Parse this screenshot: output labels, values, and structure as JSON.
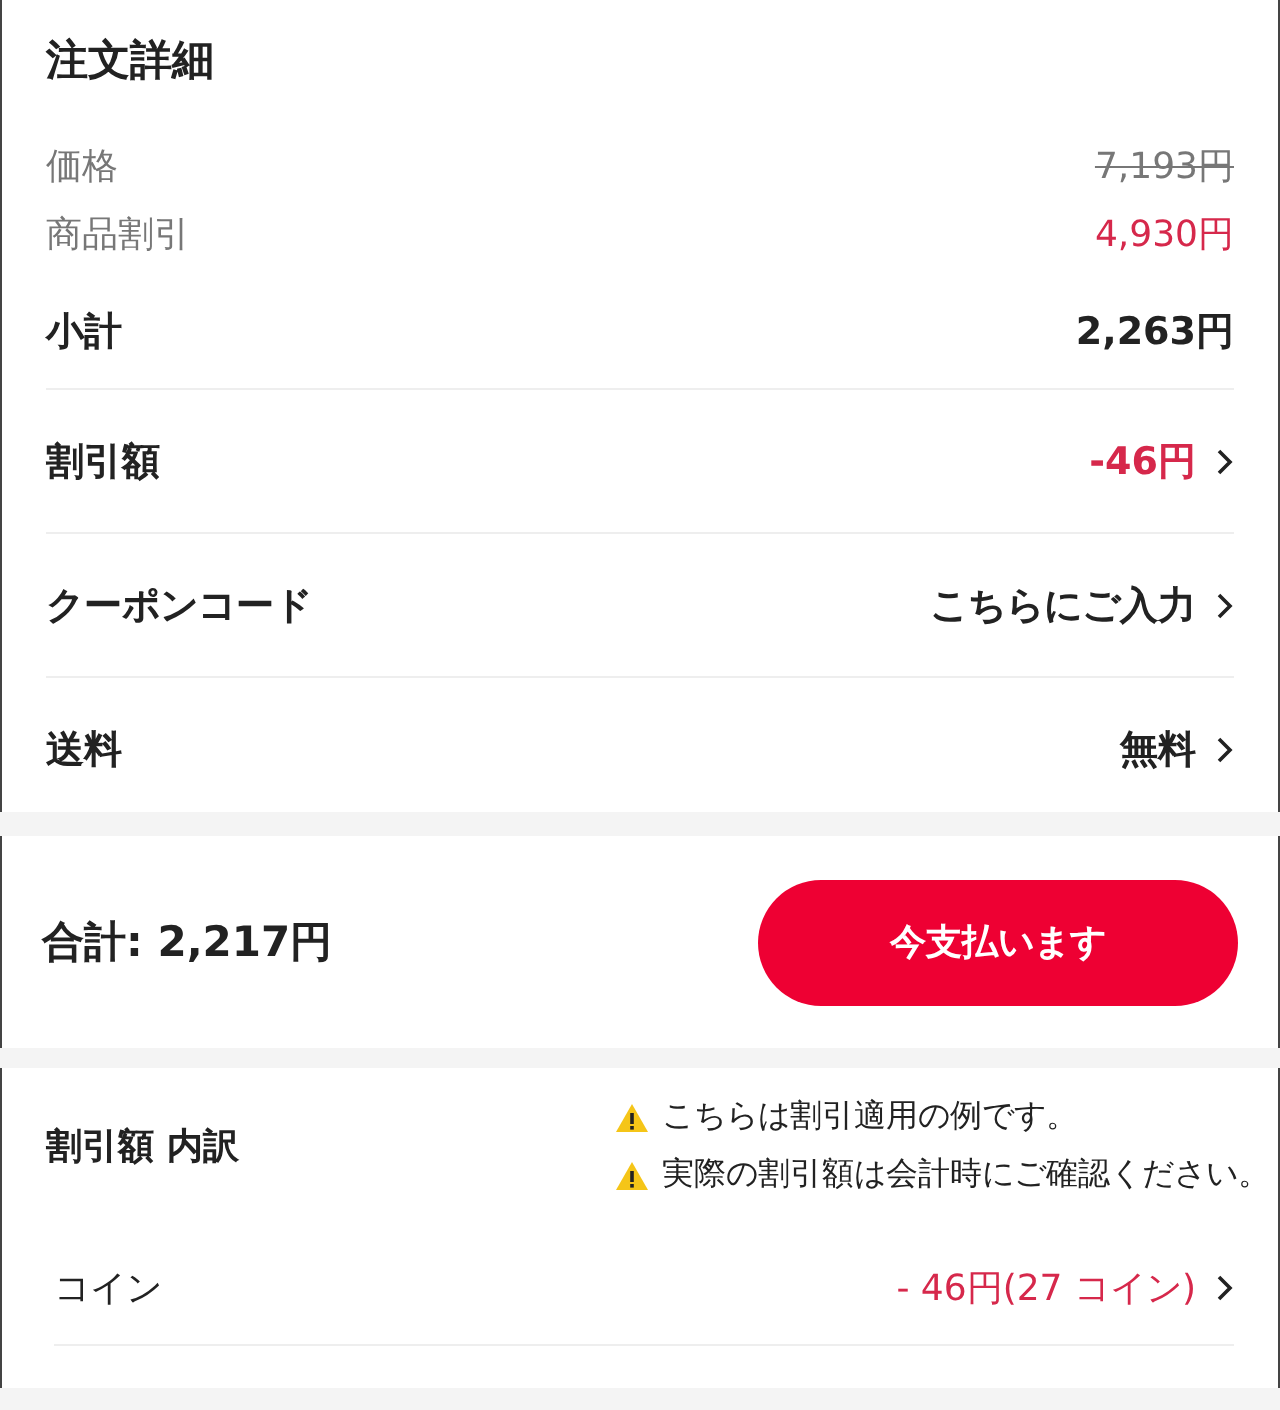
{
  "order_details": {
    "title": "注文詳細",
    "rows": [
      {
        "kind": "minor",
        "label": "価格",
        "value": "7,193円",
        "struck": true,
        "red": false,
        "chevron": false
      },
      {
        "kind": "minor",
        "label": "商品割引",
        "value": "4,930円",
        "struck": false,
        "red": true,
        "chevron": false
      },
      {
        "kind": "major",
        "label": "小計",
        "value": "2,263円",
        "struck": false,
        "red": false,
        "chevron": false
      },
      {
        "kind": "major",
        "label": "割引額",
        "value": "-46円",
        "struck": false,
        "red": true,
        "chevron": true
      },
      {
        "kind": "major",
        "label": "クーポンコード",
        "value": "こちらにご入力",
        "struck": false,
        "red": false,
        "chevron": true
      },
      {
        "kind": "major",
        "label": "送料",
        "value": "無料",
        "struck": false,
        "red": false,
        "chevron": true
      }
    ]
  },
  "checkout": {
    "total": "合計: 2,217円",
    "pay_button": "今支払います"
  },
  "breakdown": {
    "title": "割引額 内訳",
    "notices": [
      "こちらは割引適用の例です。",
      "実際の割引額は会計時にご確認ください。"
    ],
    "rows": [
      {
        "label": "コイン",
        "value": "- 46円(27 コイン)"
      }
    ]
  }
}
